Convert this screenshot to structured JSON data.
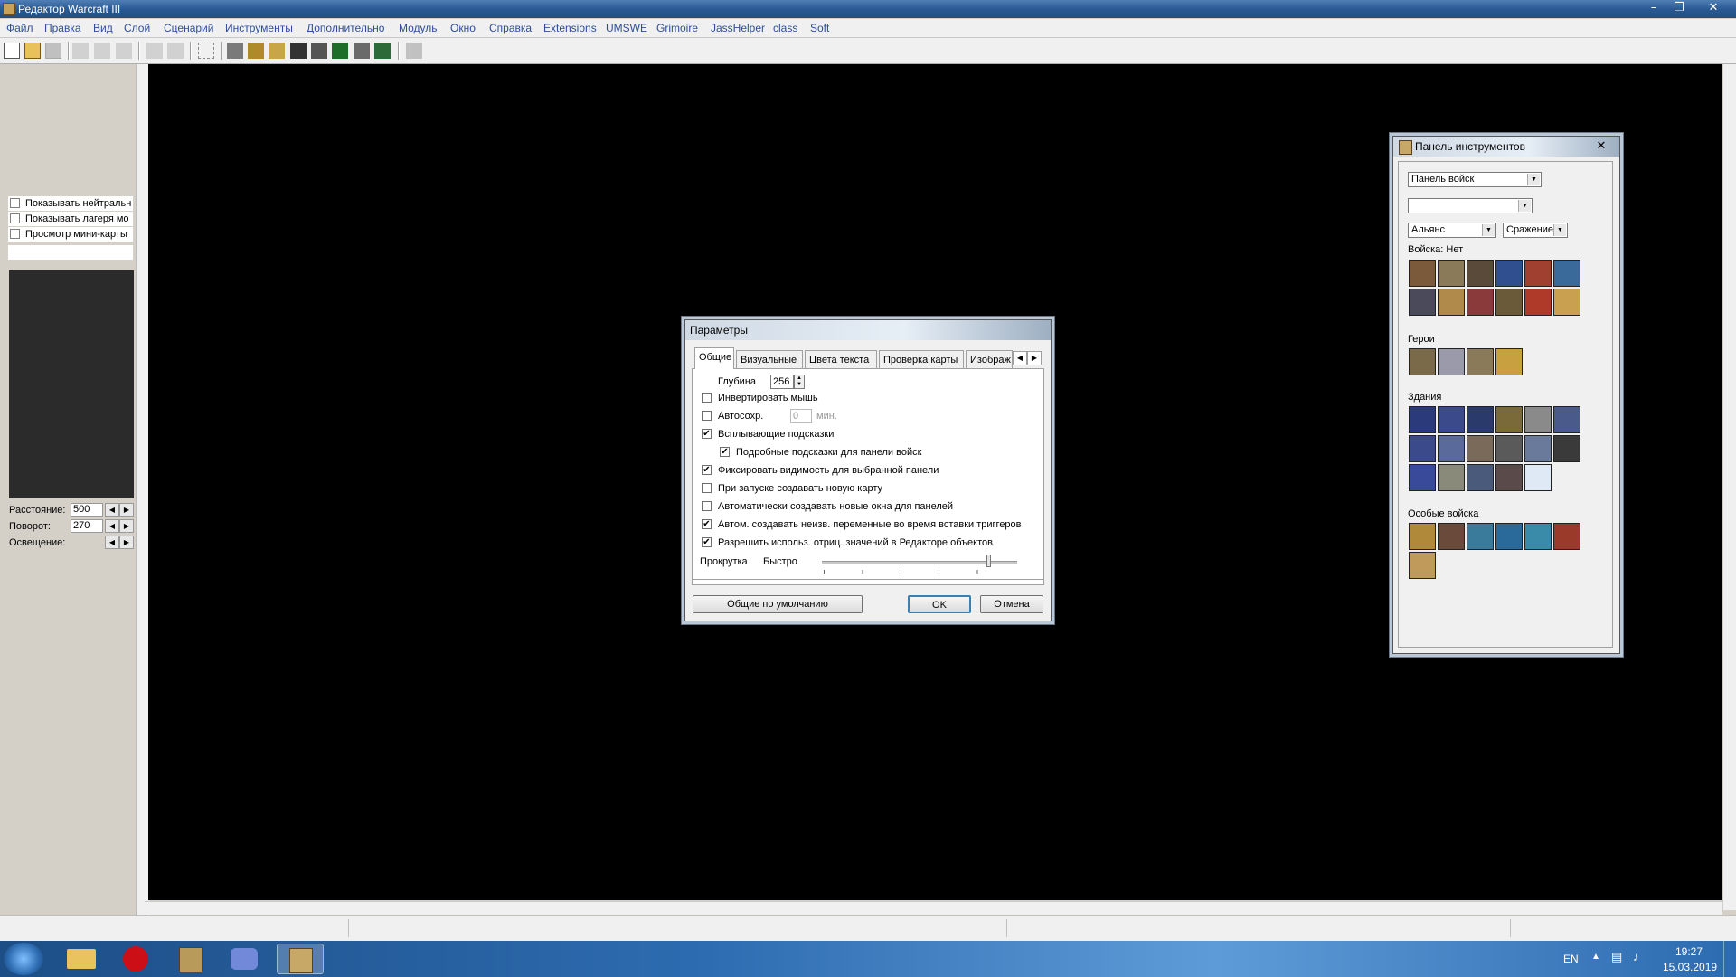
{
  "window": {
    "title": "Редактор Warcraft III"
  },
  "menu": [
    "Файл",
    "Правка",
    "Вид",
    "Слой",
    "Сценарий",
    "Инструменты",
    "Дополнительно",
    "Модуль",
    "Окно",
    "Справка",
    "Extensions",
    "UMSWE",
    "Grimoire",
    "JassHelper",
    "class",
    "Soft"
  ],
  "left_panel": {
    "checks": [
      "Показывать нейтральн",
      "Показывать лагеря мо",
      "Просмотр мини-карты"
    ],
    "camera": [
      {
        "label": "Расстояние:",
        "value": "500"
      },
      {
        "label": "Поворот:",
        "value": "270"
      },
      {
        "label": "Освещение:",
        "value": ""
      }
    ]
  },
  "dialog": {
    "title": "Параметры",
    "tabs": [
      "Общие",
      "Визуальные",
      "Цвета текста",
      "Проверка карты",
      "Изображ"
    ],
    "depth_label": "Глубина",
    "depth_value": "256",
    "options": [
      {
        "label": "Инвертировать мышь",
        "checked": false
      },
      {
        "label": "Автосохр.",
        "checked": false
      },
      {
        "label": "Всплывающие подсказки",
        "checked": true
      },
      {
        "label": "Подробные подсказки для панели войск",
        "checked": true
      },
      {
        "label": "Фиксировать видимость для выбранной панели",
        "checked": true
      },
      {
        "label": "При запуске создавать новую карту",
        "checked": false
      },
      {
        "label": "Автоматически создавать новые окна для панелей",
        "checked": false
      },
      {
        "label": "Автом. создавать неизв. переменные во время вставки триггеров",
        "checked": true
      },
      {
        "label": "Разрешить использ. отриц. значений в Редакторе объектов",
        "checked": true
      }
    ],
    "autosave_value": "0",
    "autosave_unit": "мин.",
    "scroll_label": "Прокрутка",
    "scroll_speed": "Быстро",
    "scroll_level": 0.85,
    "buttons": {
      "defaults": "Общие по умолчанию",
      "ok": "OK",
      "cancel": "Отмена"
    }
  },
  "palette": {
    "title": "Панель инструментов",
    "panel_select": "Панель войск",
    "sub_select": "",
    "race_select": "Альянс",
    "mode_select": "Сражение",
    "sections": {
      "units": "Войска: Нет",
      "heroes": "Герои",
      "buildings": "Здания",
      "special": "Особые войска"
    }
  },
  "taskbar": {
    "lang": "EN",
    "time": "19:27",
    "date": "15.03.2019"
  }
}
